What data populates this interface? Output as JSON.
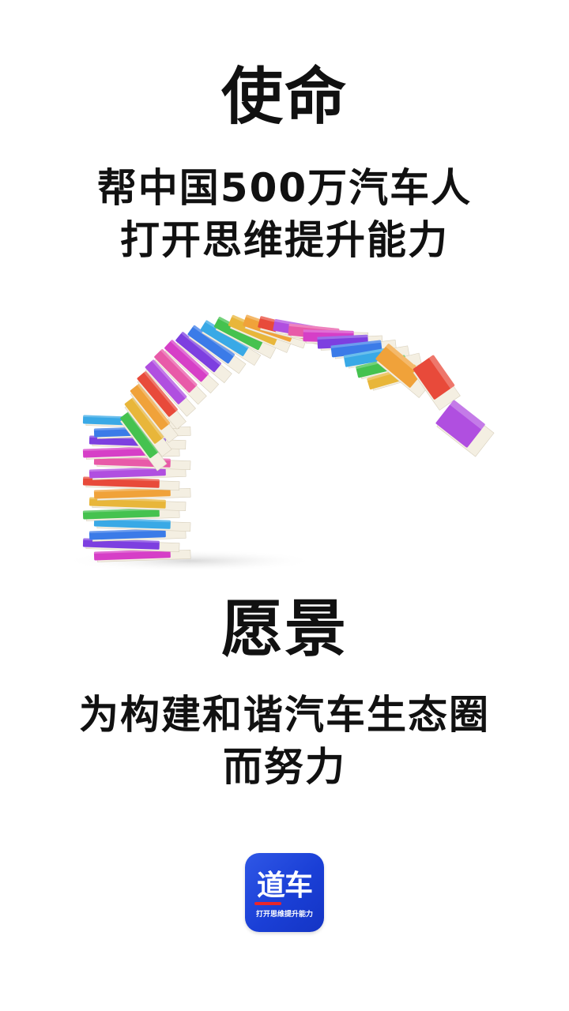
{
  "mission": {
    "title": "使命",
    "lines": [
      "帮中国500万汽车人",
      "打开思维提升能力"
    ]
  },
  "vision": {
    "title": "愿景",
    "lines": [
      "为构建和谐汽车生态圈",
      "而努力"
    ]
  },
  "illustration": {
    "name": "flying-books",
    "colors": [
      "#d63fc7",
      "#7d3fe0",
      "#3b7be8",
      "#39a9e6",
      "#45c24f",
      "#e8b63a",
      "#f0a23a",
      "#e84a3a",
      "#b04fe0",
      "#e85aa8"
    ]
  },
  "logo": {
    "name": "道车",
    "tagline": "打开思维提升能力",
    "colors": {
      "background": "#1f45d8",
      "accent": "#e8262b",
      "text": "#ffffff"
    }
  }
}
